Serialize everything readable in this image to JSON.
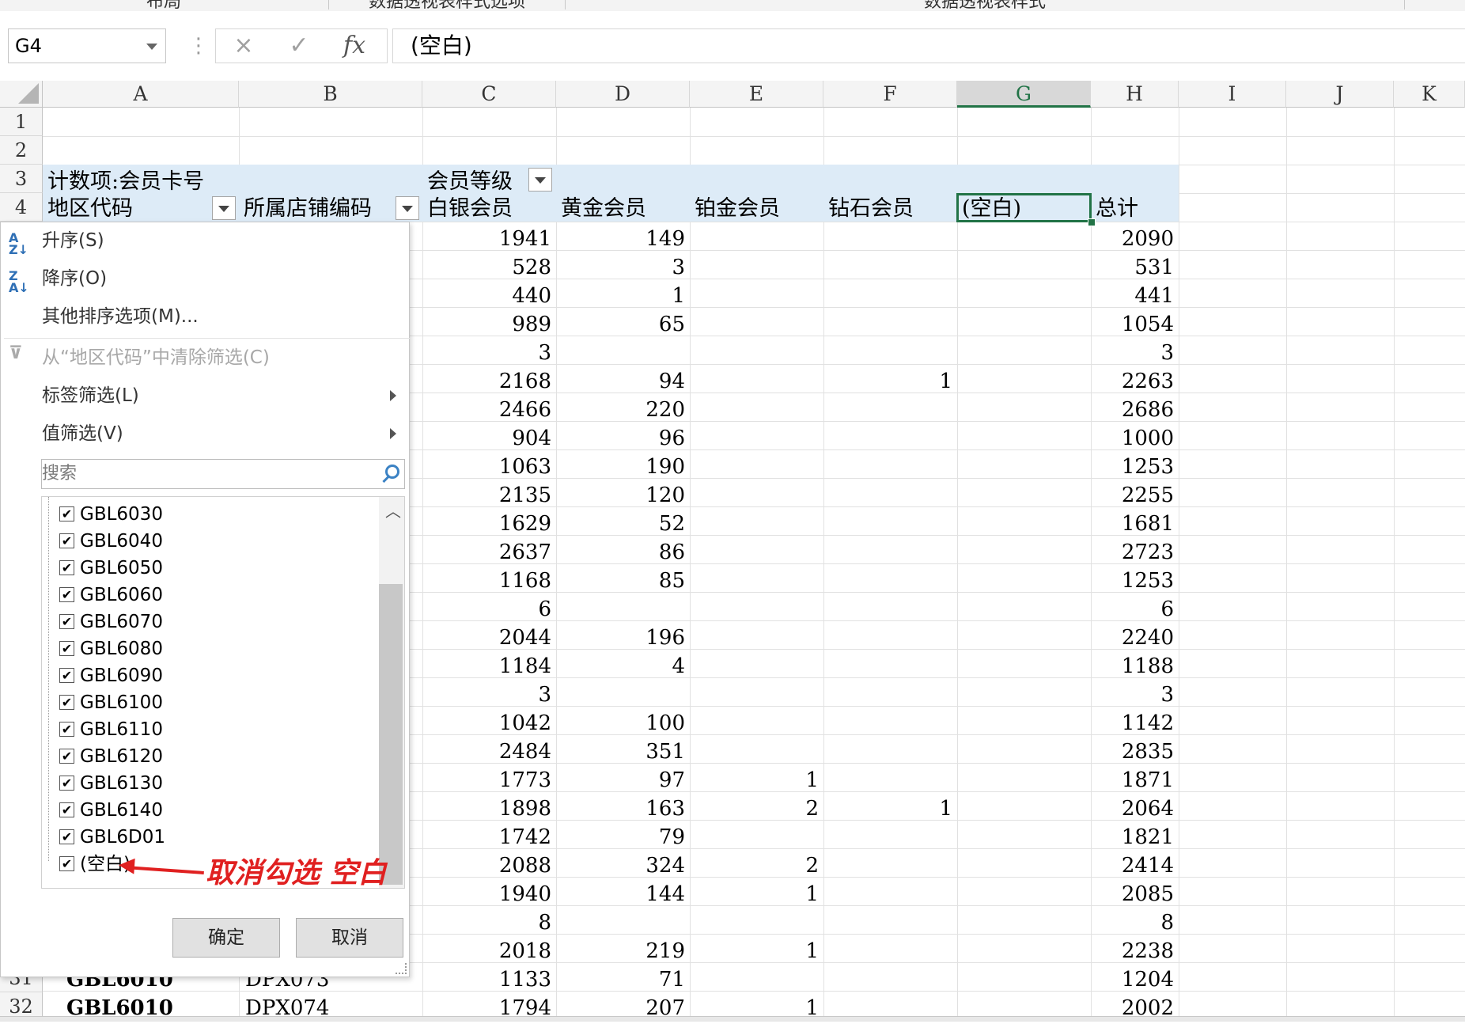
{
  "ribbon": {
    "groups": [
      "布局",
      "数据透视表样式选项",
      "数据透视表样式"
    ]
  },
  "formula_bar": {
    "name_box": "G4",
    "cancel_icon": "×",
    "enter_icon": "✓",
    "fx_label": "fx",
    "formula": "(空白)"
  },
  "columns": [
    "A",
    "B",
    "C",
    "D",
    "E",
    "F",
    "G",
    "H",
    "I",
    "J",
    "K"
  ],
  "selected_column": "G",
  "rows": [
    "1",
    "2",
    "3",
    "4",
    "31",
    "32"
  ],
  "pivot": {
    "value_field": "计数项:会员卡号",
    "column_field": "会员等级",
    "row_field_1": "地区代码",
    "row_field_2": "所属店铺编码",
    "headers": [
      "白银会员",
      "黄金会员",
      "铂金会员",
      "钻石会员",
      "(空白)",
      "总计"
    ],
    "data_rows": [
      [
        "1941",
        "149",
        "",
        "",
        "",
        "2090"
      ],
      [
        "528",
        "3",
        "",
        "",
        "",
        "531"
      ],
      [
        "440",
        "1",
        "",
        "",
        "",
        "441"
      ],
      [
        "989",
        "65",
        "",
        "",
        "",
        "1054"
      ],
      [
        "3",
        "",
        "",
        "",
        "",
        "3"
      ],
      [
        "2168",
        "94",
        "",
        "1",
        "",
        "2263"
      ],
      [
        "2466",
        "220",
        "",
        "",
        "",
        "2686"
      ],
      [
        "904",
        "96",
        "",
        "",
        "",
        "1000"
      ],
      [
        "1063",
        "190",
        "",
        "",
        "",
        "1253"
      ],
      [
        "2135",
        "120",
        "",
        "",
        "",
        "2255"
      ],
      [
        "1629",
        "52",
        "",
        "",
        "",
        "1681"
      ],
      [
        "2637",
        "86",
        "",
        "",
        "",
        "2723"
      ],
      [
        "1168",
        "85",
        "",
        "",
        "",
        "1253"
      ],
      [
        "6",
        "",
        "",
        "",
        "",
        "6"
      ],
      [
        "2044",
        "196",
        "",
        "",
        "",
        "2240"
      ],
      [
        "1184",
        "4",
        "",
        "",
        "",
        "1188"
      ],
      [
        "3",
        "",
        "",
        "",
        "",
        "3"
      ],
      [
        "1042",
        "100",
        "",
        "",
        "",
        "1142"
      ],
      [
        "2484",
        "351",
        "",
        "",
        "",
        "2835"
      ],
      [
        "1773",
        "97",
        "1",
        "",
        "",
        "1871"
      ],
      [
        "1898",
        "163",
        "2",
        "1",
        "",
        "2064"
      ],
      [
        "1742",
        "79",
        "",
        "",
        "",
        "1821"
      ],
      [
        "2088",
        "324",
        "2",
        "",
        "",
        "2414"
      ],
      [
        "1940",
        "144",
        "1",
        "",
        "",
        "2085"
      ],
      [
        "8",
        "",
        "",
        "",
        "",
        "8"
      ],
      [
        "2018",
        "219",
        "1",
        "",
        "",
        "2238"
      ],
      [
        "1133",
        "71",
        "",
        "",
        "",
        "1204"
      ],
      [
        "1794",
        "207",
        "1",
        "",
        "",
        "2002"
      ]
    ],
    "visible_rows": [
      {
        "a": "GBL6010",
        "b": "DPX073"
      },
      {
        "a": "GBL6010",
        "b": "DPX074"
      }
    ]
  },
  "filter_menu": {
    "sort_asc": "升序(S)",
    "sort_desc": "降序(O)",
    "more_sort": "其他排序选项(M)...",
    "clear_filter": "从“地区代码”中清除筛选(C)",
    "label_filter": "标签筛选(L)",
    "value_filter": "值筛选(V)",
    "search_placeholder": "搜索",
    "items": [
      {
        "label": "GBL6030",
        "checked": true
      },
      {
        "label": "GBL6040",
        "checked": true
      },
      {
        "label": "GBL6050",
        "checked": true
      },
      {
        "label": "GBL6060",
        "checked": true
      },
      {
        "label": "GBL6070",
        "checked": true
      },
      {
        "label": "GBL6080",
        "checked": true
      },
      {
        "label": "GBL6090",
        "checked": true
      },
      {
        "label": "GBL6100",
        "checked": true
      },
      {
        "label": "GBL6110",
        "checked": true
      },
      {
        "label": "GBL6120",
        "checked": true
      },
      {
        "label": "GBL6130",
        "checked": true
      },
      {
        "label": "GBL6140",
        "checked": true
      },
      {
        "label": "GBL6D01",
        "checked": true
      },
      {
        "label": "(空白)",
        "checked": true
      }
    ],
    "ok": "确定",
    "cancel": "取消",
    "check_glyph": "✔"
  },
  "annotation": "取消勾选 空白",
  "colors": {
    "accent": "#217346",
    "pivot_header": "#ddebf7",
    "annotation": "#e02020"
  }
}
